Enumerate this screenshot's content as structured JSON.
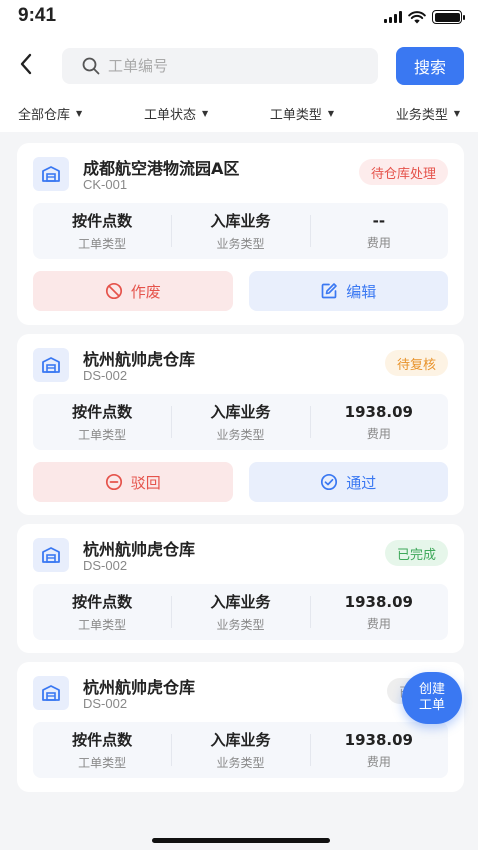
{
  "status_bar": {
    "time": "9:41"
  },
  "search": {
    "placeholder": "工单编号",
    "button_label": "搜索"
  },
  "filters": [
    {
      "label": "全部仓库"
    },
    {
      "label": "工单状态"
    },
    {
      "label": "工单类型"
    },
    {
      "label": "业务类型"
    }
  ],
  "orders": [
    {
      "warehouse": "成都航空港物流园A区",
      "code": "CK-001",
      "status": "待仓库处理",
      "order_type": "按件点数",
      "order_type_label": "工单类型",
      "business_type": "入库业务",
      "business_type_label": "业务类型",
      "fee": "--",
      "fee_label": "费用",
      "actions": [
        "作废",
        "编辑"
      ]
    },
    {
      "warehouse": "杭州航帅虎仓库",
      "code": "DS-002",
      "status": "待复核",
      "order_type": "按件点数",
      "order_type_label": "工单类型",
      "business_type": "入库业务",
      "business_type_label": "业务类型",
      "fee": "1938.09",
      "fee_label": "费用",
      "actions": [
        "驳回",
        "通过"
      ]
    },
    {
      "warehouse": "杭州航帅虎仓库",
      "code": "DS-002",
      "status": "已完成",
      "order_type": "按件点数",
      "order_type_label": "工单类型",
      "business_type": "入库业务",
      "business_type_label": "业务类型",
      "fee": "1938.09",
      "fee_label": "费用"
    },
    {
      "warehouse": "杭州航帅虎仓库",
      "code": "DS-002",
      "status": "已",
      "order_type": "按件点数",
      "order_type_label": "工单类型",
      "business_type": "入库业务",
      "business_type_label": "业务类型",
      "fee": "1938.09",
      "fee_label": "费用"
    }
  ],
  "fab": {
    "line1": "创建",
    "line2": "工单"
  },
  "colors": {
    "primary": "#3a78f2",
    "danger": "#e5534b",
    "warning": "#e8932c",
    "success": "#3fa85a"
  }
}
